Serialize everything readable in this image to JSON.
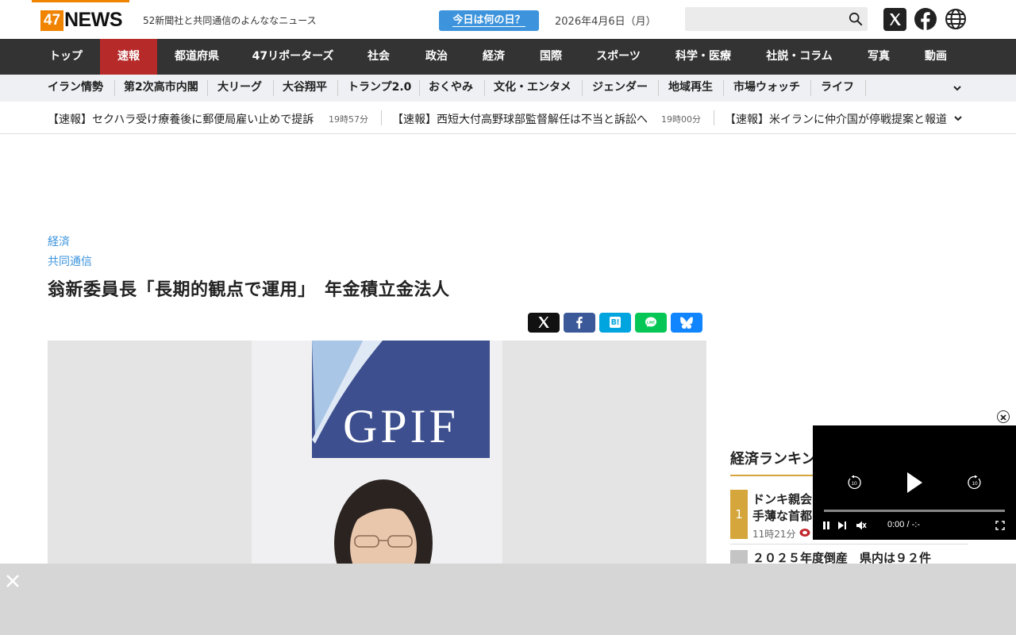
{
  "header": {
    "logo_number": "47",
    "logo_word": "NEWS",
    "tagline": "52新聞社と共同通信のよんななニュース",
    "today_button": "今日は何の日？",
    "date": "2026年4月6日（月）",
    "search_placeholder": ""
  },
  "main_nav": [
    {
      "label": "トップ",
      "active": false
    },
    {
      "label": "速報",
      "active": true
    },
    {
      "label": "都道府県",
      "active": false
    },
    {
      "label": "47リポーターズ",
      "active": false
    },
    {
      "label": "社会",
      "active": false
    },
    {
      "label": "政治",
      "active": false
    },
    {
      "label": "経済",
      "active": false
    },
    {
      "label": "国際",
      "active": false
    },
    {
      "label": "スポーツ",
      "active": false
    },
    {
      "label": "科学・医療",
      "active": false
    },
    {
      "label": "社説・コラム",
      "active": false
    },
    {
      "label": "写真",
      "active": false
    },
    {
      "label": "動画",
      "active": false
    }
  ],
  "sub_nav": [
    "イラン情勢",
    "第2次高市内閣",
    "大リーグ",
    "大谷翔平",
    "トランプ2.0",
    "おくやみ",
    "文化・エンタメ",
    "ジェンダー",
    "地域再生",
    "市場ウォッチ",
    "ライフ"
  ],
  "breaking": [
    {
      "title": "【速報】セクハラ受け療養後に郵便局雇い止めで提訴",
      "time": "19時57分"
    },
    {
      "title": "【速報】西短大付高野球部監督解任は不当と訴訟へ",
      "time": "19時00分"
    },
    {
      "title": "【速報】米イランに仲介国が停戦提案と報道",
      "time": ""
    }
  ],
  "article": {
    "category": "経済",
    "source": "共同通信",
    "headline": "翁新委員長「長期的観点で運用」　年金積立金法人",
    "photo_sign": "GPIF"
  },
  "ranking": {
    "title": "経済ランキング",
    "items": [
      {
        "rank": "1",
        "line1": "ドンキ親会",
        "line2": "手薄な首都",
        "time": "11時21分"
      },
      {
        "rank": "",
        "line1": "２０２５年度倒産　県内は９２件",
        "line2": "",
        "time": ""
      }
    ]
  },
  "player": {
    "current": "0:00",
    "separator": "/",
    "duration": "-:-",
    "rewind": "10",
    "forward": "10"
  },
  "colors": {
    "brand_orange": "#f08300",
    "nav_dark": "#333333",
    "active_red": "#b72a2a",
    "link_blue": "#3d94dc",
    "rank_gold": "#d4a63b"
  }
}
